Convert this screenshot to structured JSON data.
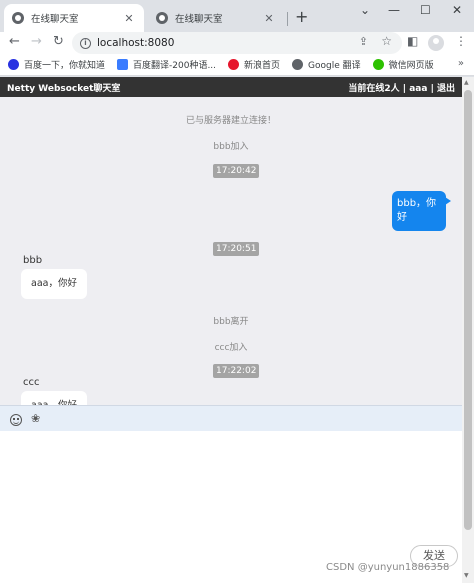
{
  "tabs": [
    {
      "title": "在线聊天室",
      "close": "✕"
    },
    {
      "title": "在线聊天室",
      "close": "✕"
    }
  ],
  "newtab": "+",
  "window_controls": {
    "chevron": "⌄",
    "minimize": "—",
    "maximize": "☐",
    "close": "✕"
  },
  "nav": {
    "back": "←",
    "forward": "→",
    "reload": "↻"
  },
  "address": {
    "url": "localhost:8080",
    "info": "i"
  },
  "bookmarks": [
    {
      "label": "百度一下，你就知道",
      "color": "#2932e1"
    },
    {
      "label": "百度翻译-200种语...",
      "color": "#3a7cff"
    },
    {
      "label": "新浪首页",
      "color": "#e6162d"
    },
    {
      "label": "Google 翻译",
      "color": "#4285f4"
    },
    {
      "label": "微信网页版",
      "color": "#2dc100"
    }
  ],
  "bookmarks_more": "»",
  "app": {
    "title": "Netty Websocket聊天室",
    "status": "当前在线2人 | aaa | 退出"
  },
  "messages": {
    "sys_connected": "已与服务器建立连接！",
    "sys_bbb_join": "bbb加入",
    "time1": "17:20:42",
    "my_msg": "bbb，你好",
    "time2": "17:20:51",
    "sender_bbb": "bbb",
    "bbb_msg": "aaa，你好",
    "sys_bbb_leave": "bbb离开",
    "sys_ccc_join": "ccc加入",
    "time3": "17:22:02",
    "sender_ccc": "ccc",
    "ccc_msg": "aaa，你好"
  },
  "input": {
    "send": "发送",
    "flower": "❀"
  },
  "watermark": "CSDN @yunyun1886358"
}
